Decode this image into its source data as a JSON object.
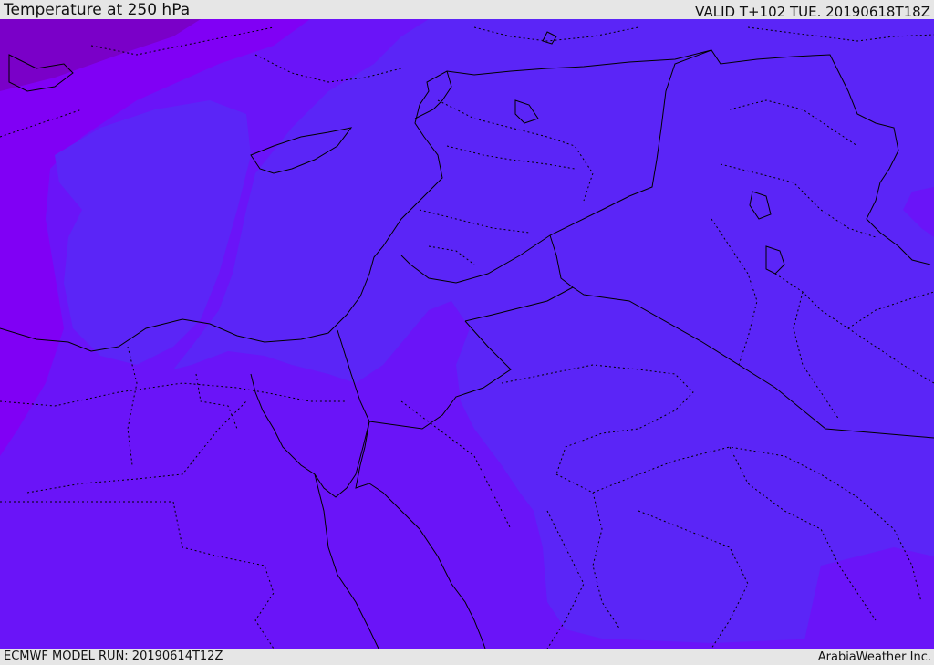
{
  "header": {
    "title": "Temperature at 250 hPa",
    "valid": "VALID T+102 TUE. 20190618T18Z"
  },
  "footer": {
    "model_run": "ECMWF MODEL RUN: 20190614T12Z",
    "credit": "ArabiaWeather Inc."
  },
  "colors": {
    "coldest": "#7a00c8",
    "cold": "#8000f5",
    "mid": "#6a14f8",
    "warm": "#5b25f7",
    "borders": "#000000"
  }
}
